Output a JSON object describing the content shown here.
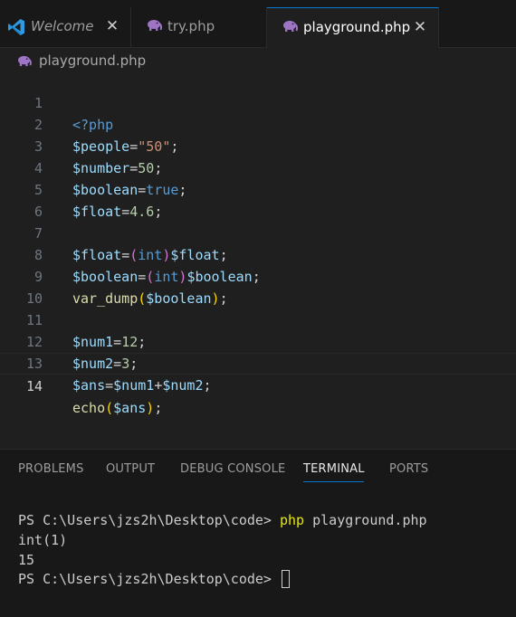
{
  "tabs": [
    {
      "label": "Welcome",
      "icon": "vscode-logo-icon",
      "italic": true
    },
    {
      "label": "try.php",
      "icon": "php-elephant-icon"
    },
    {
      "label": "playground.php",
      "icon": "php-elephant-icon",
      "active": true
    }
  ],
  "breadcrumb": {
    "file": "playground.php"
  },
  "editor": {
    "active_line": "14",
    "line_numbers": [
      "1",
      "2",
      "3",
      "4",
      "5",
      "6",
      "7",
      "8",
      "9",
      "10",
      "11",
      "12",
      "13",
      "14"
    ],
    "code": [
      "<?php",
      "$people=\"50\";",
      "$number=50;",
      "$boolean=true;",
      "$float=4.6;",
      "",
      "$float=(int)$float;",
      "$boolean=(int)$boolean;",
      "var_dump($boolean);",
      "",
      "$num1=12;",
      "$num2=3;",
      "$ans=$num1+$num2;",
      "echo($ans);"
    ]
  },
  "panel": {
    "tabs": [
      "PROBLEMS",
      "OUTPUT",
      "DEBUG CONSOLE",
      "TERMINAL",
      "PORTS"
    ],
    "active_tab": "TERMINAL",
    "terminal": {
      "prompt": "PS C:\\Users\\jzs2h\\Desktop\\code> ",
      "command": "php",
      "command_args": " playground.php",
      "output": [
        "int(1)",
        "15"
      ],
      "prompt2": "PS C:\\Users\\jzs2h\\Desktop\\code> "
    }
  },
  "colors": {
    "accent": "#0078d4",
    "editor_bg": "#1f1f1f",
    "panel_bg": "#181818"
  }
}
